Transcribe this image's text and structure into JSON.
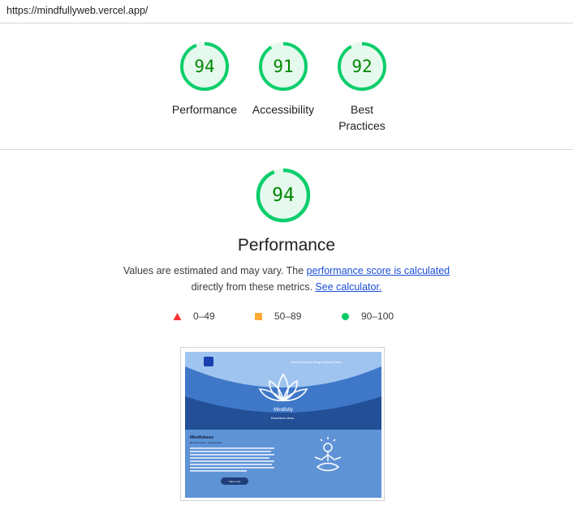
{
  "url": "https://mindfullyweb.vercel.app/",
  "scores": [
    {
      "value": "94",
      "label": "Performance"
    },
    {
      "value": "91",
      "label": "Accessibility"
    },
    {
      "value": "92",
      "label": "Best Practices"
    }
  ],
  "score_fractions": [
    0.94,
    0.91,
    0.92
  ],
  "performance": {
    "score": "94",
    "fraction": 0.94,
    "title": "Performance",
    "desc_prefix": "Values are estimated and may vary. The ",
    "desc_link": "performance score is calculated",
    "desc_middle": "directly from these metrics. ",
    "desc_link2": "See calculator."
  },
  "legend": [
    {
      "shape": "triangle",
      "color": "#ff3333",
      "label": "0–49"
    },
    {
      "shape": "square",
      "color": "#ffaa33",
      "label": "50–89"
    },
    {
      "shape": "circle",
      "color": "#00cc66",
      "label": "90–100"
    }
  ],
  "colors": {
    "pass": "#0cce6b",
    "pass_text": "#008800",
    "pass_fill": "#e6f9ee"
  },
  "screenshot": {
    "brand": "Mindfully",
    "tagline": "Encuentra tu calma...",
    "nav": "Inicio   Mindfulness   Blogs   Contacto   Libros",
    "section_title": "Mindfulness",
    "section_sub": "Bienestar interior · Seguir leyendo",
    "body": "Mindfulness es una práctica que te ayuda a vivir el presente, reconocer tus emociones y reducir el estrés cada día con calma y atención plena.",
    "button": "Saber más"
  }
}
